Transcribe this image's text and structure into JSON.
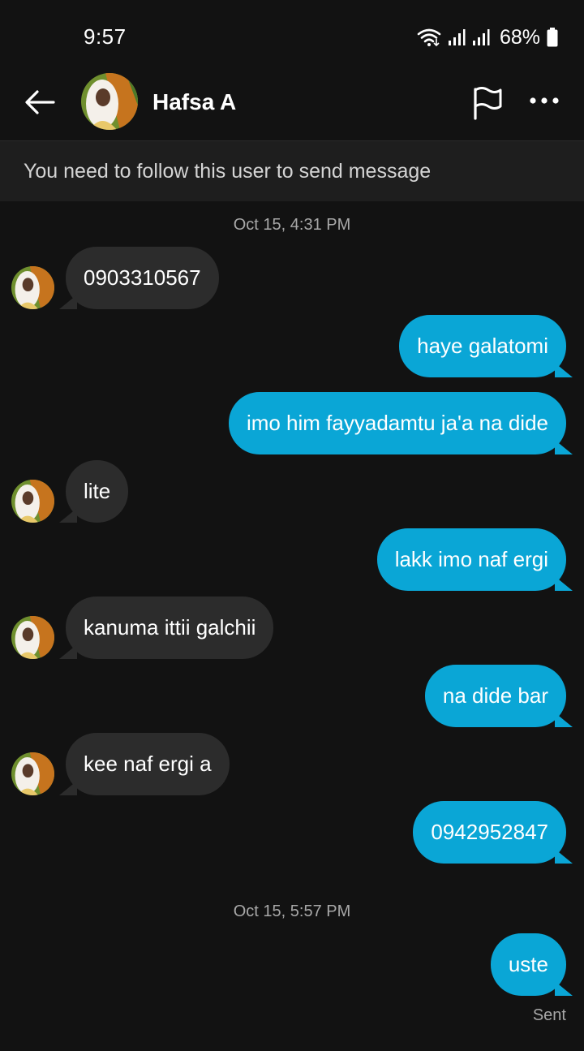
{
  "status_bar": {
    "time": "9:57",
    "battery": "68%",
    "icons": [
      "wifi-icon",
      "signal-icon",
      "signal-icon",
      "battery-icon"
    ]
  },
  "header": {
    "contact_name": "Hafsa A",
    "icons": [
      "back-arrow-icon",
      "flag-icon",
      "more-icon"
    ]
  },
  "notice": {
    "text": "You need to follow this user to send message"
  },
  "conversation": {
    "timestamps": [
      "Oct 15, 4:31 PM",
      "Oct 15, 5:57 PM"
    ],
    "messages": [
      {
        "direction": "incoming",
        "text": "0903310567"
      },
      {
        "direction": "outgoing",
        "text": "haye galatomi"
      },
      {
        "direction": "outgoing",
        "text": "imo him fayyadamtu ja'a na dide"
      },
      {
        "direction": "incoming",
        "text": "lite"
      },
      {
        "direction": "outgoing",
        "text": "lakk imo naf ergi"
      },
      {
        "direction": "incoming",
        "text": "kanuma ittii galchii"
      },
      {
        "direction": "outgoing",
        "text": "na dide bar"
      },
      {
        "direction": "incoming",
        "text": "kee naf ergi a"
      },
      {
        "direction": "outgoing",
        "text": "0942952847"
      },
      {
        "direction": "outgoing",
        "text": "uste"
      }
    ],
    "last_status": "Sent"
  },
  "colors": {
    "background": "#121212",
    "incoming_bubble": "#2c2c2c",
    "outgoing_bubble": "#0aa6d6",
    "notice_background": "#1e1e1e"
  }
}
